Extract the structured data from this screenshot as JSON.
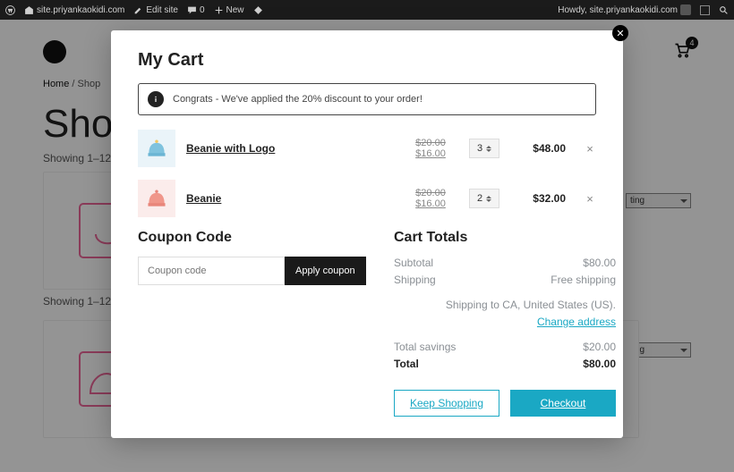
{
  "wpbar": {
    "site": "site.priyankaokidi.com",
    "edit": "Edit site",
    "comments": "0",
    "new": "New",
    "howdy": "Howdy, site.priyankaokidi.com"
  },
  "page": {
    "breadcrumb_home": "Home",
    "breadcrumb_sep": " / ",
    "breadcrumb_current": "Shop",
    "title": "Shop",
    "showing": "Showing 1–12",
    "sort_label": "ting",
    "cart_count": "4"
  },
  "cart": {
    "title": "My Cart",
    "notice": "Congrats - We've applied the 20% discount to your order!",
    "items": [
      {
        "name": "Beanie with Logo",
        "original": "$20.00",
        "sale": "$16.00",
        "qty": "3",
        "total": "$48.00"
      },
      {
        "name": "Beanie",
        "original": "$20.00",
        "sale": "$16.00",
        "qty": "2",
        "total": "$32.00"
      }
    ],
    "coupon": {
      "heading": "Coupon Code",
      "placeholder": "Coupon code",
      "button": "Apply coupon"
    },
    "totals": {
      "heading": "Cart Totals",
      "subtotal_label": "Subtotal",
      "subtotal": "$80.00",
      "shipping_label": "Shipping",
      "shipping": "Free shipping",
      "ship_to": "Shipping to CA, United States (US).",
      "change_addr": "Change address",
      "savings_label": "Total savings",
      "savings": "$20.00",
      "total_label": "Total",
      "total": "$80.00"
    },
    "buttons": {
      "keep": "Keep Shopping",
      "checkout": "Checkout"
    }
  }
}
